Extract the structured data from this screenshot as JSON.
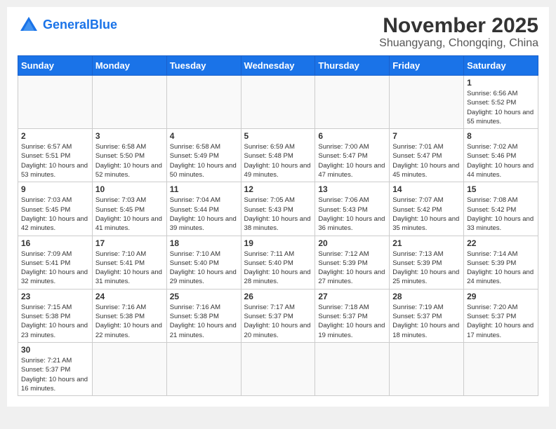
{
  "logo": {
    "general": "General",
    "blue": "Blue"
  },
  "header": {
    "month": "November 2025",
    "location": "Shuangyang, Chongqing, China"
  },
  "weekdays": [
    "Sunday",
    "Monday",
    "Tuesday",
    "Wednesday",
    "Thursday",
    "Friday",
    "Saturday"
  ],
  "weeks": [
    [
      {
        "day": "",
        "info": ""
      },
      {
        "day": "",
        "info": ""
      },
      {
        "day": "",
        "info": ""
      },
      {
        "day": "",
        "info": ""
      },
      {
        "day": "",
        "info": ""
      },
      {
        "day": "",
        "info": ""
      },
      {
        "day": "1",
        "info": "Sunrise: 6:56 AM\nSunset: 5:52 PM\nDaylight: 10 hours and 55 minutes."
      }
    ],
    [
      {
        "day": "2",
        "info": "Sunrise: 6:57 AM\nSunset: 5:51 PM\nDaylight: 10 hours and 53 minutes."
      },
      {
        "day": "3",
        "info": "Sunrise: 6:58 AM\nSunset: 5:50 PM\nDaylight: 10 hours and 52 minutes."
      },
      {
        "day": "4",
        "info": "Sunrise: 6:58 AM\nSunset: 5:49 PM\nDaylight: 10 hours and 50 minutes."
      },
      {
        "day": "5",
        "info": "Sunrise: 6:59 AM\nSunset: 5:48 PM\nDaylight: 10 hours and 49 minutes."
      },
      {
        "day": "6",
        "info": "Sunrise: 7:00 AM\nSunset: 5:47 PM\nDaylight: 10 hours and 47 minutes."
      },
      {
        "day": "7",
        "info": "Sunrise: 7:01 AM\nSunset: 5:47 PM\nDaylight: 10 hours and 45 minutes."
      },
      {
        "day": "8",
        "info": "Sunrise: 7:02 AM\nSunset: 5:46 PM\nDaylight: 10 hours and 44 minutes."
      }
    ],
    [
      {
        "day": "9",
        "info": "Sunrise: 7:03 AM\nSunset: 5:45 PM\nDaylight: 10 hours and 42 minutes."
      },
      {
        "day": "10",
        "info": "Sunrise: 7:03 AM\nSunset: 5:45 PM\nDaylight: 10 hours and 41 minutes."
      },
      {
        "day": "11",
        "info": "Sunrise: 7:04 AM\nSunset: 5:44 PM\nDaylight: 10 hours and 39 minutes."
      },
      {
        "day": "12",
        "info": "Sunrise: 7:05 AM\nSunset: 5:43 PM\nDaylight: 10 hours and 38 minutes."
      },
      {
        "day": "13",
        "info": "Sunrise: 7:06 AM\nSunset: 5:43 PM\nDaylight: 10 hours and 36 minutes."
      },
      {
        "day": "14",
        "info": "Sunrise: 7:07 AM\nSunset: 5:42 PM\nDaylight: 10 hours and 35 minutes."
      },
      {
        "day": "15",
        "info": "Sunrise: 7:08 AM\nSunset: 5:42 PM\nDaylight: 10 hours and 33 minutes."
      }
    ],
    [
      {
        "day": "16",
        "info": "Sunrise: 7:09 AM\nSunset: 5:41 PM\nDaylight: 10 hours and 32 minutes."
      },
      {
        "day": "17",
        "info": "Sunrise: 7:10 AM\nSunset: 5:41 PM\nDaylight: 10 hours and 31 minutes."
      },
      {
        "day": "18",
        "info": "Sunrise: 7:10 AM\nSunset: 5:40 PM\nDaylight: 10 hours and 29 minutes."
      },
      {
        "day": "19",
        "info": "Sunrise: 7:11 AM\nSunset: 5:40 PM\nDaylight: 10 hours and 28 minutes."
      },
      {
        "day": "20",
        "info": "Sunrise: 7:12 AM\nSunset: 5:39 PM\nDaylight: 10 hours and 27 minutes."
      },
      {
        "day": "21",
        "info": "Sunrise: 7:13 AM\nSunset: 5:39 PM\nDaylight: 10 hours and 25 minutes."
      },
      {
        "day": "22",
        "info": "Sunrise: 7:14 AM\nSunset: 5:39 PM\nDaylight: 10 hours and 24 minutes."
      }
    ],
    [
      {
        "day": "23",
        "info": "Sunrise: 7:15 AM\nSunset: 5:38 PM\nDaylight: 10 hours and 23 minutes."
      },
      {
        "day": "24",
        "info": "Sunrise: 7:16 AM\nSunset: 5:38 PM\nDaylight: 10 hours and 22 minutes."
      },
      {
        "day": "25",
        "info": "Sunrise: 7:16 AM\nSunset: 5:38 PM\nDaylight: 10 hours and 21 minutes."
      },
      {
        "day": "26",
        "info": "Sunrise: 7:17 AM\nSunset: 5:37 PM\nDaylight: 10 hours and 20 minutes."
      },
      {
        "day": "27",
        "info": "Sunrise: 7:18 AM\nSunset: 5:37 PM\nDaylight: 10 hours and 19 minutes."
      },
      {
        "day": "28",
        "info": "Sunrise: 7:19 AM\nSunset: 5:37 PM\nDaylight: 10 hours and 18 minutes."
      },
      {
        "day": "29",
        "info": "Sunrise: 7:20 AM\nSunset: 5:37 PM\nDaylight: 10 hours and 17 minutes."
      }
    ],
    [
      {
        "day": "30",
        "info": "Sunrise: 7:21 AM\nSunset: 5:37 PM\nDaylight: 10 hours and 16 minutes."
      },
      {
        "day": "",
        "info": ""
      },
      {
        "day": "",
        "info": ""
      },
      {
        "day": "",
        "info": ""
      },
      {
        "day": "",
        "info": ""
      },
      {
        "day": "",
        "info": ""
      },
      {
        "day": "",
        "info": ""
      }
    ]
  ]
}
